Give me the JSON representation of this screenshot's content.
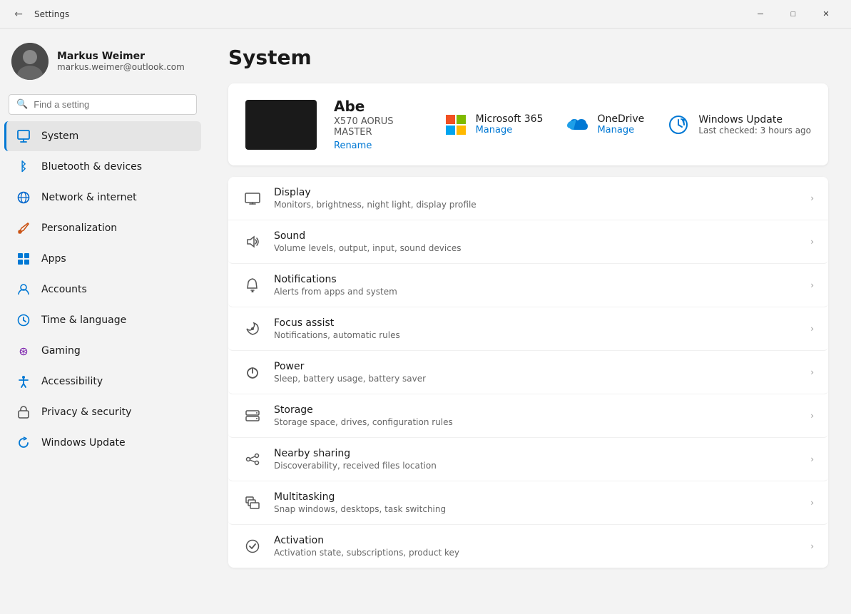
{
  "titlebar": {
    "title": "Settings",
    "back_label": "←",
    "minimize_label": "─",
    "maximize_label": "□",
    "close_label": "✕"
  },
  "search": {
    "placeholder": "Find a setting"
  },
  "user": {
    "name": "Markus Weimer",
    "email": "markus.weimer@outlook.com"
  },
  "nav": {
    "items": [
      {
        "id": "system",
        "label": "System",
        "icon": "⊞",
        "active": true
      },
      {
        "id": "bluetooth",
        "label": "Bluetooth & devices",
        "icon": "⚡"
      },
      {
        "id": "network",
        "label": "Network & internet",
        "icon": "🌐"
      },
      {
        "id": "personalization",
        "label": "Personalization",
        "icon": "✏"
      },
      {
        "id": "apps",
        "label": "Apps",
        "icon": "⊡"
      },
      {
        "id": "accounts",
        "label": "Accounts",
        "icon": "👤"
      },
      {
        "id": "time",
        "label": "Time & language",
        "icon": "🕐"
      },
      {
        "id": "gaming",
        "label": "Gaming",
        "icon": "🎮"
      },
      {
        "id": "accessibility",
        "label": "Accessibility",
        "icon": "♿"
      },
      {
        "id": "privacy",
        "label": "Privacy & security",
        "icon": "🛡"
      },
      {
        "id": "update",
        "label": "Windows Update",
        "icon": "↻"
      }
    ]
  },
  "page": {
    "title": "System"
  },
  "computer": {
    "name": "Abe",
    "model": "X570 AORUS MASTER",
    "rename_label": "Rename"
  },
  "services": [
    {
      "id": "ms365",
      "name": "Microsoft 365",
      "action": "Manage"
    },
    {
      "id": "onedrive",
      "name": "OneDrive",
      "action": "Manage"
    },
    {
      "id": "winupdate",
      "name": "Windows Update",
      "status": "Last checked: 3 hours ago"
    }
  ],
  "settings_rows": [
    {
      "id": "display",
      "title": "Display",
      "desc": "Monitors, brightness, night light, display profile",
      "icon": "🖥"
    },
    {
      "id": "sound",
      "title": "Sound",
      "desc": "Volume levels, output, input, sound devices",
      "icon": "🔊"
    },
    {
      "id": "notifications",
      "title": "Notifications",
      "desc": "Alerts from apps and system",
      "icon": "🔔"
    },
    {
      "id": "focus",
      "title": "Focus assist",
      "desc": "Notifications, automatic rules",
      "icon": "🌙"
    },
    {
      "id": "power",
      "title": "Power",
      "desc": "Sleep, battery usage, battery saver",
      "icon": "⏻"
    },
    {
      "id": "storage",
      "title": "Storage",
      "desc": "Storage space, drives, configuration rules",
      "icon": "🗄"
    },
    {
      "id": "nearby",
      "title": "Nearby sharing",
      "desc": "Discoverability, received files location",
      "icon": "⇌"
    },
    {
      "id": "multitasking",
      "title": "Multitasking",
      "desc": "Snap windows, desktops, task switching",
      "icon": "⧉"
    },
    {
      "id": "activation",
      "title": "Activation",
      "desc": "Activation state, subscriptions, product key",
      "icon": "✓"
    }
  ]
}
